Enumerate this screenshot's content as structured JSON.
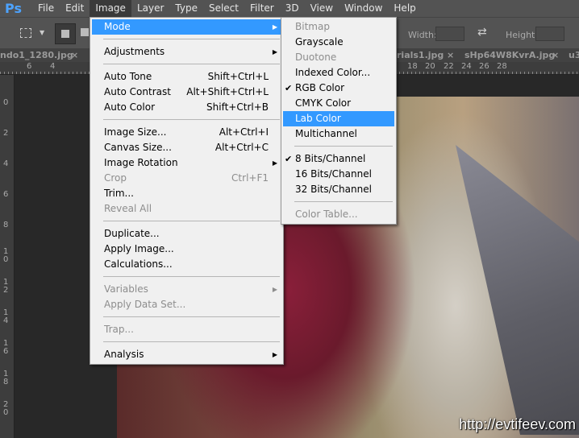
{
  "app": {
    "logo": "Ps"
  },
  "menubar": [
    "File",
    "Edit",
    "Image",
    "Layer",
    "Type",
    "Select",
    "Filter",
    "3D",
    "View",
    "Window",
    "Help"
  ],
  "options": {
    "width_label": "Width:",
    "height_label": "Height:",
    "swap_icon": "swap-arrows-icon"
  },
  "tabs": [
    "ndo1_1280.jpg",
    "rials1.jpg",
    "sHp64W8KvrA.jpg",
    "u3"
  ],
  "tab_close": "×",
  "ruler_h": [
    "6",
    "4",
    "18",
    "20",
    "22",
    "24",
    "26",
    "28"
  ],
  "ruler_v": [
    "0",
    "2",
    "4",
    "6",
    "8",
    "1\n0",
    "1\n2",
    "1\n4",
    "1\n6",
    "1\n8",
    "2\n0"
  ],
  "image_menu": [
    {
      "label": "Mode",
      "arrow": true,
      "highlight": true
    },
    {
      "sep": true
    },
    {
      "label": "Adjustments",
      "arrow": true
    },
    {
      "sep": true
    },
    {
      "label": "Auto Tone",
      "shortcut": "Shift+Ctrl+L"
    },
    {
      "label": "Auto Contrast",
      "shortcut": "Alt+Shift+Ctrl+L"
    },
    {
      "label": "Auto Color",
      "shortcut": "Shift+Ctrl+B"
    },
    {
      "sep": true
    },
    {
      "label": "Image Size...",
      "shortcut": "Alt+Ctrl+I"
    },
    {
      "label": "Canvas Size...",
      "shortcut": "Alt+Ctrl+C"
    },
    {
      "label": "Image Rotation",
      "arrow": true
    },
    {
      "label": "Crop",
      "disabled": true,
      "shortcut": "Ctrl+F1"
    },
    {
      "label": "Trim..."
    },
    {
      "label": "Reveal All",
      "disabled": true
    },
    {
      "sep": true
    },
    {
      "label": "Duplicate..."
    },
    {
      "label": "Apply Image..."
    },
    {
      "label": "Calculations..."
    },
    {
      "sep": true
    },
    {
      "label": "Variables",
      "disabled": true,
      "arrow": true
    },
    {
      "label": "Apply Data Set...",
      "disabled": true
    },
    {
      "sep": true
    },
    {
      "label": "Trap...",
      "disabled": true
    },
    {
      "sep": true
    },
    {
      "label": "Analysis",
      "arrow": true
    }
  ],
  "mode_menu": [
    {
      "label": "Bitmap",
      "disabled": true
    },
    {
      "label": "Grayscale"
    },
    {
      "label": "Duotone",
      "disabled": true
    },
    {
      "label": "Indexed Color..."
    },
    {
      "label": "RGB Color",
      "checked": true
    },
    {
      "label": "CMYK Color"
    },
    {
      "label": "Lab Color",
      "highlight": true
    },
    {
      "label": "Multichannel"
    },
    {
      "sep": true
    },
    {
      "label": "8 Bits/Channel",
      "checked": true
    },
    {
      "label": "16 Bits/Channel"
    },
    {
      "label": "32 Bits/Channel"
    },
    {
      "sep": true
    },
    {
      "label": "Color Table...",
      "disabled": true
    }
  ],
  "watermark": "http://evtifeev.com"
}
